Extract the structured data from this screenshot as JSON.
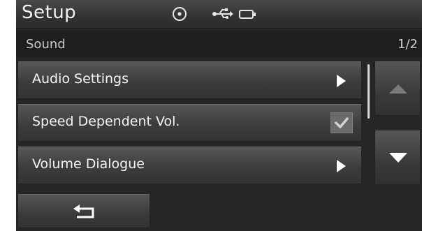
{
  "header": {
    "title": "Setup",
    "status_icons": [
      "disc-icon",
      "usb-icon",
      "ipod-icon"
    ]
  },
  "section": {
    "label": "Sound",
    "page_indicator": "1/2"
  },
  "menu": {
    "items": [
      {
        "label": "Audio Settings",
        "control": "chevron-right-icon"
      },
      {
        "label": "Speed Dependent Vol.",
        "control": "checkbox",
        "checked": true
      },
      {
        "label": "Volume Dialogue",
        "control": "chevron-right-icon"
      }
    ]
  },
  "scroll": {
    "up_icon": "triangle-up-icon",
    "up_enabled": false,
    "down_icon": "triangle-down-icon",
    "down_enabled": true
  },
  "footer": {
    "back_icon": "back-arrow-icon"
  },
  "colors": {
    "background": "#262626",
    "text": "#f5f5f5",
    "subtext": "#c9c9c9"
  }
}
